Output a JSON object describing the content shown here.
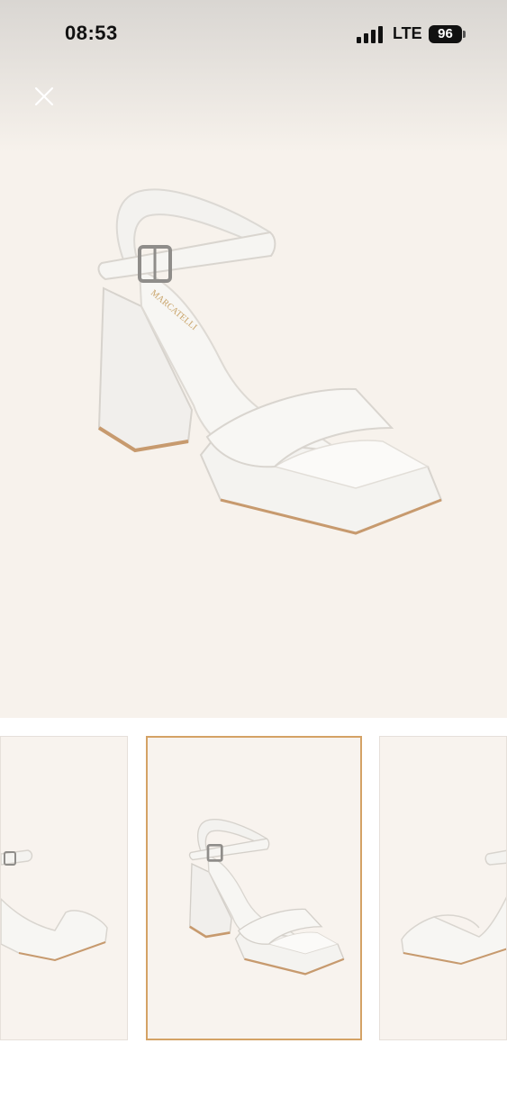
{
  "status_bar": {
    "time": "08:53",
    "network": "LTE",
    "battery": "96"
  },
  "icons": {
    "close": "close-icon",
    "signal": "signal-icon",
    "battery": "battery-icon"
  },
  "colors": {
    "hero_background": "#f7f2ec",
    "selected_thumbnail_border": "#d4a265",
    "shoe": "#f5f4f1",
    "sole_edge": "#c79a6e"
  },
  "gallery": {
    "thumbnails": [
      {
        "view": "side-left",
        "selected": false
      },
      {
        "view": "three-quarter",
        "selected": true
      },
      {
        "view": "side-right",
        "selected": false
      }
    ]
  }
}
